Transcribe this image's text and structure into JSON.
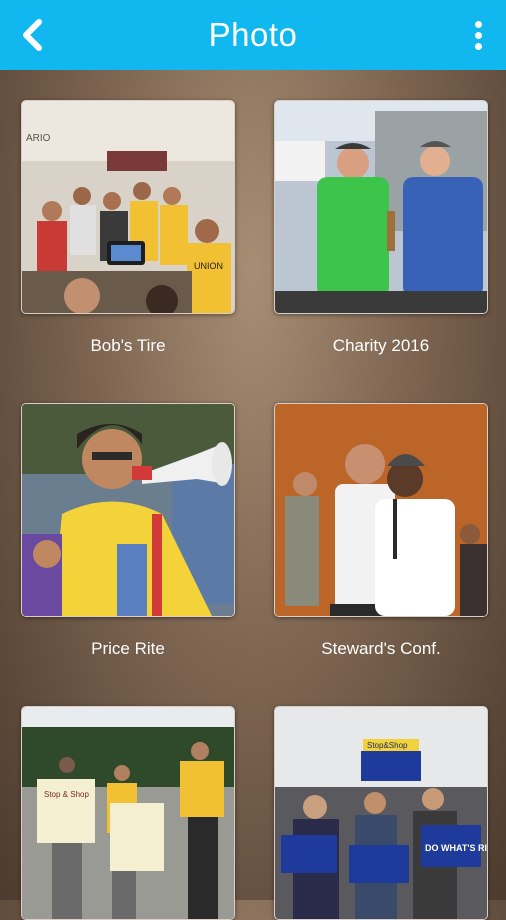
{
  "header": {
    "title": "Photo"
  },
  "albums": [
    {
      "label": "Bob's Tire"
    },
    {
      "label": "Charity 2016"
    },
    {
      "label": "Price Rite"
    },
    {
      "label": "Steward's Conf."
    },
    {
      "label": ""
    },
    {
      "label": ""
    }
  ],
  "photo_text": {
    "album1_sign": "ARIO",
    "album1_shirt": "UNION",
    "album5_sign": "Stop & Shop",
    "album6_badge": "Stop&Shop",
    "album6_sign": "DO WHAT'S RIGHT"
  },
  "theme": {
    "header_bg": "#11b8f0",
    "header_text": "#ffffff",
    "body_bg": "#7d6551"
  }
}
